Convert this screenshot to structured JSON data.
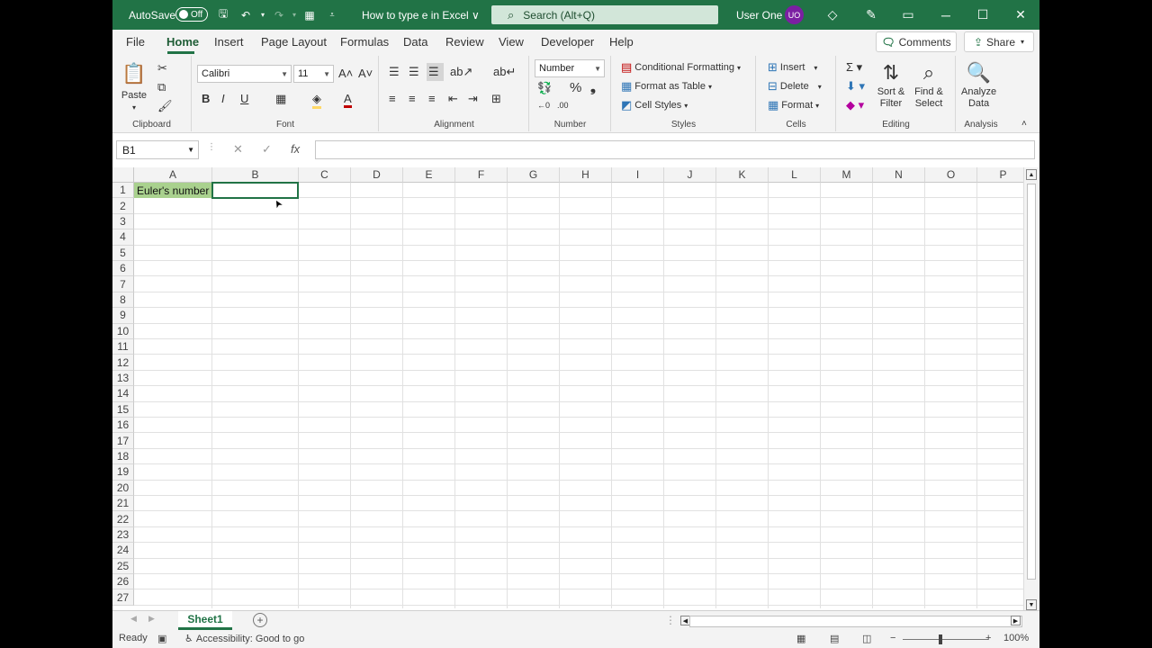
{
  "titlebar": {
    "autosave_label": "AutoSave",
    "autosave_state": "Off",
    "document_title": "How to type e in Excel ∨",
    "search_placeholder": "Search (Alt+Q)",
    "user_name": "User One",
    "user_initials": "UO"
  },
  "tabs": [
    "File",
    "Home",
    "Insert",
    "Page Layout",
    "Formulas",
    "Data",
    "Review",
    "View",
    "Developer",
    "Help"
  ],
  "active_tab": "Home",
  "comments_label": "Comments",
  "share_label": "Share",
  "ribbon": {
    "clipboard": {
      "paste_label": "Paste",
      "group_label": "Clipboard"
    },
    "font": {
      "font_name": "Calibri",
      "font_size": "11",
      "bold": "B",
      "italic": "I",
      "underline": "U",
      "group_label": "Font"
    },
    "alignment": {
      "group_label": "Alignment"
    },
    "number": {
      "format": "Number",
      "group_label": "Number"
    },
    "styles": {
      "conditional": "Conditional Formatting",
      "format_table": "Format as Table",
      "cell_styles": "Cell Styles",
      "group_label": "Styles"
    },
    "cells": {
      "insert": "Insert",
      "delete": "Delete",
      "format": "Format",
      "group_label": "Cells"
    },
    "editing": {
      "sort_line1": "Sort &",
      "sort_line2": "Filter",
      "find_line1": "Find &",
      "find_line2": "Select",
      "group_label": "Editing"
    },
    "analysis": {
      "line1": "Analyze",
      "line2": "Data",
      "group_label": "Analysis"
    }
  },
  "formula_bar": {
    "name_box": "B1",
    "fx": "fx",
    "formula": ""
  },
  "columns": [
    "A",
    "B",
    "C",
    "D",
    "E",
    "F",
    "G",
    "H",
    "I",
    "J",
    "K",
    "L",
    "M",
    "N",
    "O",
    "P"
  ],
  "rows": [
    "1",
    "2",
    "3",
    "4",
    "5",
    "6",
    "7",
    "8",
    "9",
    "10",
    "11",
    "12",
    "13",
    "14",
    "15",
    "16",
    "17",
    "18",
    "19",
    "20",
    "21",
    "22",
    "23",
    "24",
    "25",
    "26",
    "27"
  ],
  "cells": {
    "A1": "Euler's number",
    "B1": ""
  },
  "sheet_tab": "Sheet1",
  "status": {
    "ready": "Ready",
    "accessibility": "Accessibility: Good to go",
    "zoom": "100%"
  },
  "colors": {
    "brand": "#217346",
    "a1_fill": "#a9d18e"
  }
}
